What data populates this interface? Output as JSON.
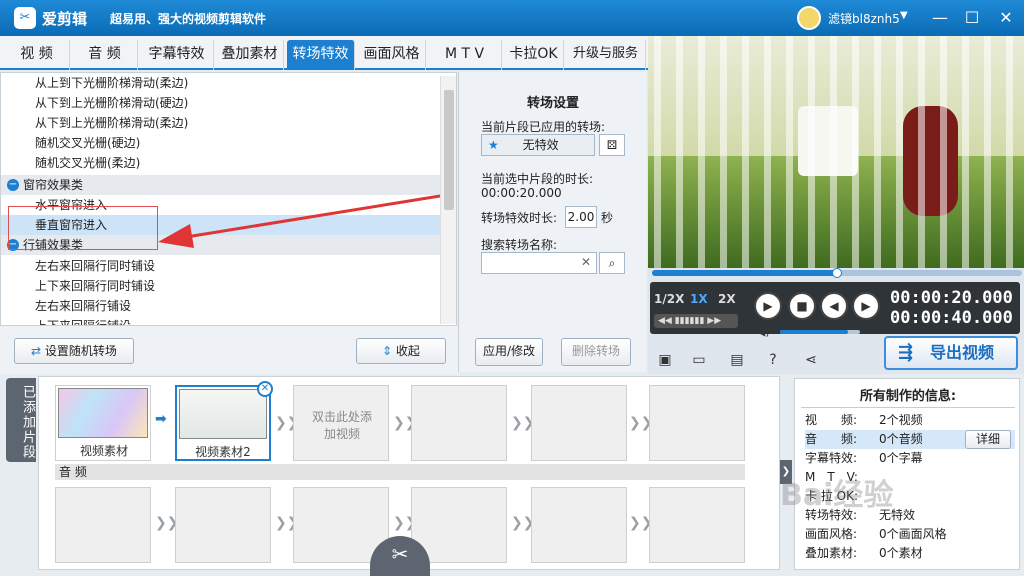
{
  "app": {
    "name": "爱剪辑",
    "slogan": "超易用、强大的视频剪辑软件",
    "username": "滤镜bl8znh5"
  },
  "tabs": [
    "视 频",
    "音 频",
    "字幕特效",
    "叠加素材",
    "转场特效",
    "画面风格",
    "M T V",
    "卡拉OK",
    "升级与服务"
  ],
  "active_tab": "转场特效",
  "list_rows": [
    {
      "type": "item",
      "label": "从上到下光栅阶梯滑动(柔边)"
    },
    {
      "type": "item",
      "label": "从下到上光栅阶梯滑动(硬边)"
    },
    {
      "type": "item",
      "label": "从下到上光栅阶梯滑动(柔边)"
    },
    {
      "type": "item",
      "label": "随机交叉光栅(硬边)"
    },
    {
      "type": "item",
      "label": "随机交叉光栅(柔边)"
    },
    {
      "type": "cat",
      "label": "窗帘效果类"
    },
    {
      "type": "item",
      "label": "水平窗帘进入"
    },
    {
      "type": "sel",
      "label": "垂直窗帘进入"
    },
    {
      "type": "cat",
      "label": "行铺效果类"
    },
    {
      "type": "item",
      "label": "左右来回隔行同时铺设"
    },
    {
      "type": "item",
      "label": "上下来回隔行同时铺设"
    },
    {
      "type": "item",
      "label": "左右来回隔行铺设"
    },
    {
      "type": "item",
      "label": "上下来回隔行铺设"
    }
  ],
  "buttons": {
    "random": "设置随机转场",
    "collapse": "收起",
    "apply": "应用/修改",
    "delete": "删除转场",
    "export": "导出视频"
  },
  "settings": {
    "title": "转场设置",
    "applied_label": "当前片段已应用的转场:",
    "applied_value": "无特效",
    "duration_label": "当前选中片段的时长:",
    "duration_value": "00:00:20.000",
    "effect_duration_label": "转场特效时长:",
    "effect_duration_value": "2.00",
    "effect_duration_unit": "秒",
    "search_label": "搜索转场名称:",
    "search_value": ""
  },
  "player": {
    "speeds": [
      "1/2X",
      "1X",
      "2X"
    ],
    "active_speed": "1X",
    "time_current": "00:00:20.000",
    "time_total": "00:00:40.000",
    "progress": 0.5,
    "volume": 0.85
  },
  "timeline": {
    "side_tab": "已添加片段",
    "clips": [
      {
        "label": "视频素材"
      },
      {
        "label": "视频素材2"
      }
    ],
    "placeholder": "双击此处添加视频",
    "audio_label": "音 频"
  },
  "info": {
    "title": "所有制作的信息:",
    "rows": [
      {
        "label": "视　　频:",
        "value": "2个视频"
      },
      {
        "label": "音　　频:",
        "value": "0个音频",
        "action": "详细"
      },
      {
        "label": "字幕特效:",
        "value": "0个字幕"
      },
      {
        "label": "M　T　V:",
        "value": ""
      },
      {
        "label": "卡 拉 OK:",
        "value": ""
      },
      {
        "label": "转场特效:",
        "value": "无特效"
      },
      {
        "label": "画面风格:",
        "value": "0个画面风格"
      },
      {
        "label": "叠加素材:",
        "value": "0个素材"
      }
    ]
  },
  "watermark": "Bai经验"
}
